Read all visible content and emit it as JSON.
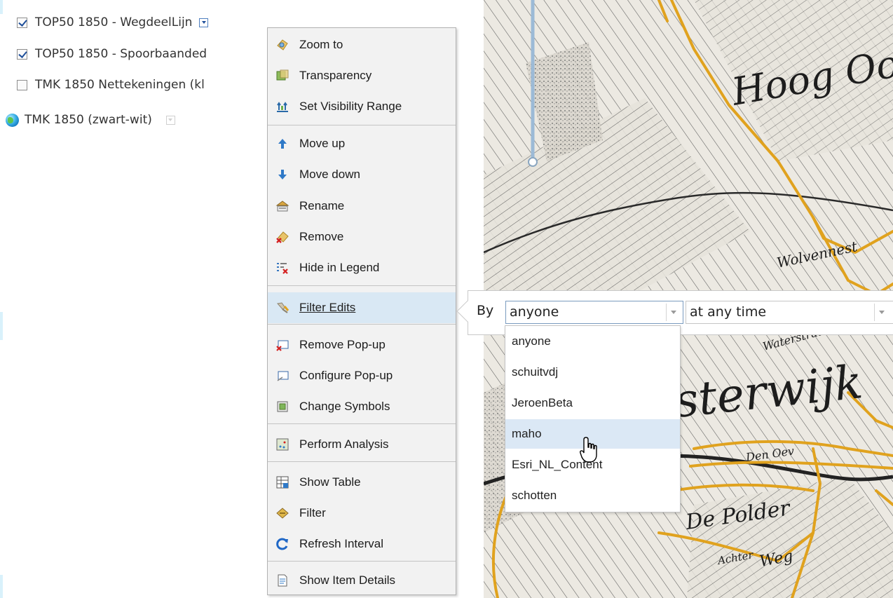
{
  "layers": [
    {
      "label": "TOP50 1850 - WegdeelLijn",
      "checked": true,
      "has_menu_button": true
    },
    {
      "label": "TOP50 1850 - Spoorbaanded",
      "checked": true
    },
    {
      "label": "TMK 1850 Nettekeningen (kl",
      "checked": false
    },
    {
      "label": "TMK 1850 (zwart-wit)",
      "icon": "globe-icon"
    }
  ],
  "context_menu": {
    "items": [
      {
        "label": "Zoom to",
        "icon": "zoom-to-icon"
      },
      {
        "label": "Transparency",
        "icon": "transparency-icon"
      },
      {
        "label": "Set Visibility Range",
        "icon": "visibility-range-icon"
      },
      {
        "label": "Move up",
        "icon": "arrow-up-icon"
      },
      {
        "label": "Move down",
        "icon": "arrow-down-icon"
      },
      {
        "label": "Rename",
        "icon": "rename-icon"
      },
      {
        "label": "Remove",
        "icon": "remove-icon"
      },
      {
        "label": "Hide in Legend",
        "icon": "hide-legend-icon"
      },
      {
        "label": "Filter Edits",
        "icon": "filter-edits-icon",
        "highlighted": true
      },
      {
        "label": "Remove Pop-up",
        "icon": "remove-popup-icon"
      },
      {
        "label": "Configure Pop-up",
        "icon": "configure-popup-icon"
      },
      {
        "label": "Change Symbols",
        "icon": "change-symbols-icon"
      },
      {
        "label": "Perform Analysis",
        "icon": "analysis-icon"
      },
      {
        "label": "Show Table",
        "icon": "table-icon"
      },
      {
        "label": "Filter",
        "icon": "filter-icon"
      },
      {
        "label": "Refresh Interval",
        "icon": "refresh-icon"
      },
      {
        "label": "Show Item Details",
        "icon": "item-details-icon"
      }
    ]
  },
  "filter_edits": {
    "by_label": "By",
    "who_value": "anyone",
    "when_value": "at any time",
    "who_options": [
      "anyone",
      "schuitvdj",
      "JeroenBeta",
      "maho",
      "Esri_NL_Content",
      "schotten"
    ],
    "hovered_option": "maho"
  },
  "map": {
    "labels": [
      "Hoog Oost",
      "sterwijk",
      "De Polder",
      "Wolvennest",
      "Weg",
      "Achter",
      "Den Oev",
      "Waterstraat"
    ]
  },
  "colors": {
    "road_overlay": "#e0a21e",
    "menu_highlight": "#d9e8f4",
    "option_hover": "#dbe8f5",
    "map_paper": "#e9e6df"
  }
}
